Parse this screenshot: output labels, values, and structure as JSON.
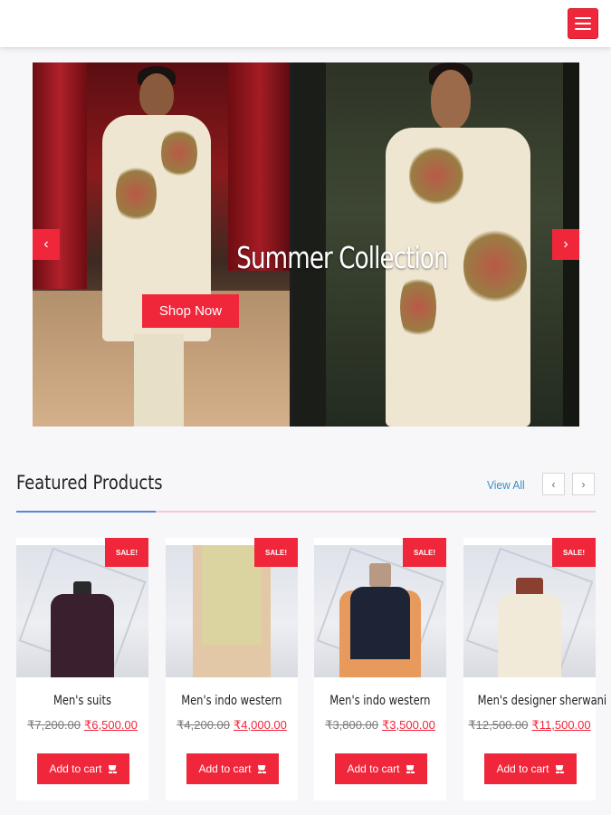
{
  "header": {
    "menu_icon": "hamburger-menu-icon",
    "accent_color": "#f0273b"
  },
  "hero": {
    "title": "Summer Collection",
    "button_label": "Shop Now",
    "prev_icon": "chevron-left-icon",
    "next_icon": "chevron-right-icon",
    "prev_glyph": "‹",
    "next_glyph": "›"
  },
  "featured": {
    "title": "Featured Products",
    "view_all_label": "View All",
    "prev_glyph": "‹",
    "next_glyph": "›"
  },
  "products": [
    {
      "sale_badge": "SALE!",
      "name": "Men's suits",
      "old_price": "₹7,200.00",
      "new_price": "₹6,500.00",
      "cart_label": "Add to cart"
    },
    {
      "sale_badge": "SALE!",
      "name": "Men's indo western",
      "old_price": "₹4,200.00",
      "new_price": "₹4,000.00",
      "cart_label": "Add to cart"
    },
    {
      "sale_badge": "SALE!",
      "name": "Men's indo western",
      "old_price": "₹3,800.00",
      "new_price": "₹3,500.00",
      "cart_label": "Add to cart"
    },
    {
      "sale_badge": "SALE!",
      "name": "Men's designer sherwani",
      "old_price": "₹12,500.00",
      "new_price": "₹11,500.00",
      "cart_label": "Add to cart"
    }
  ]
}
